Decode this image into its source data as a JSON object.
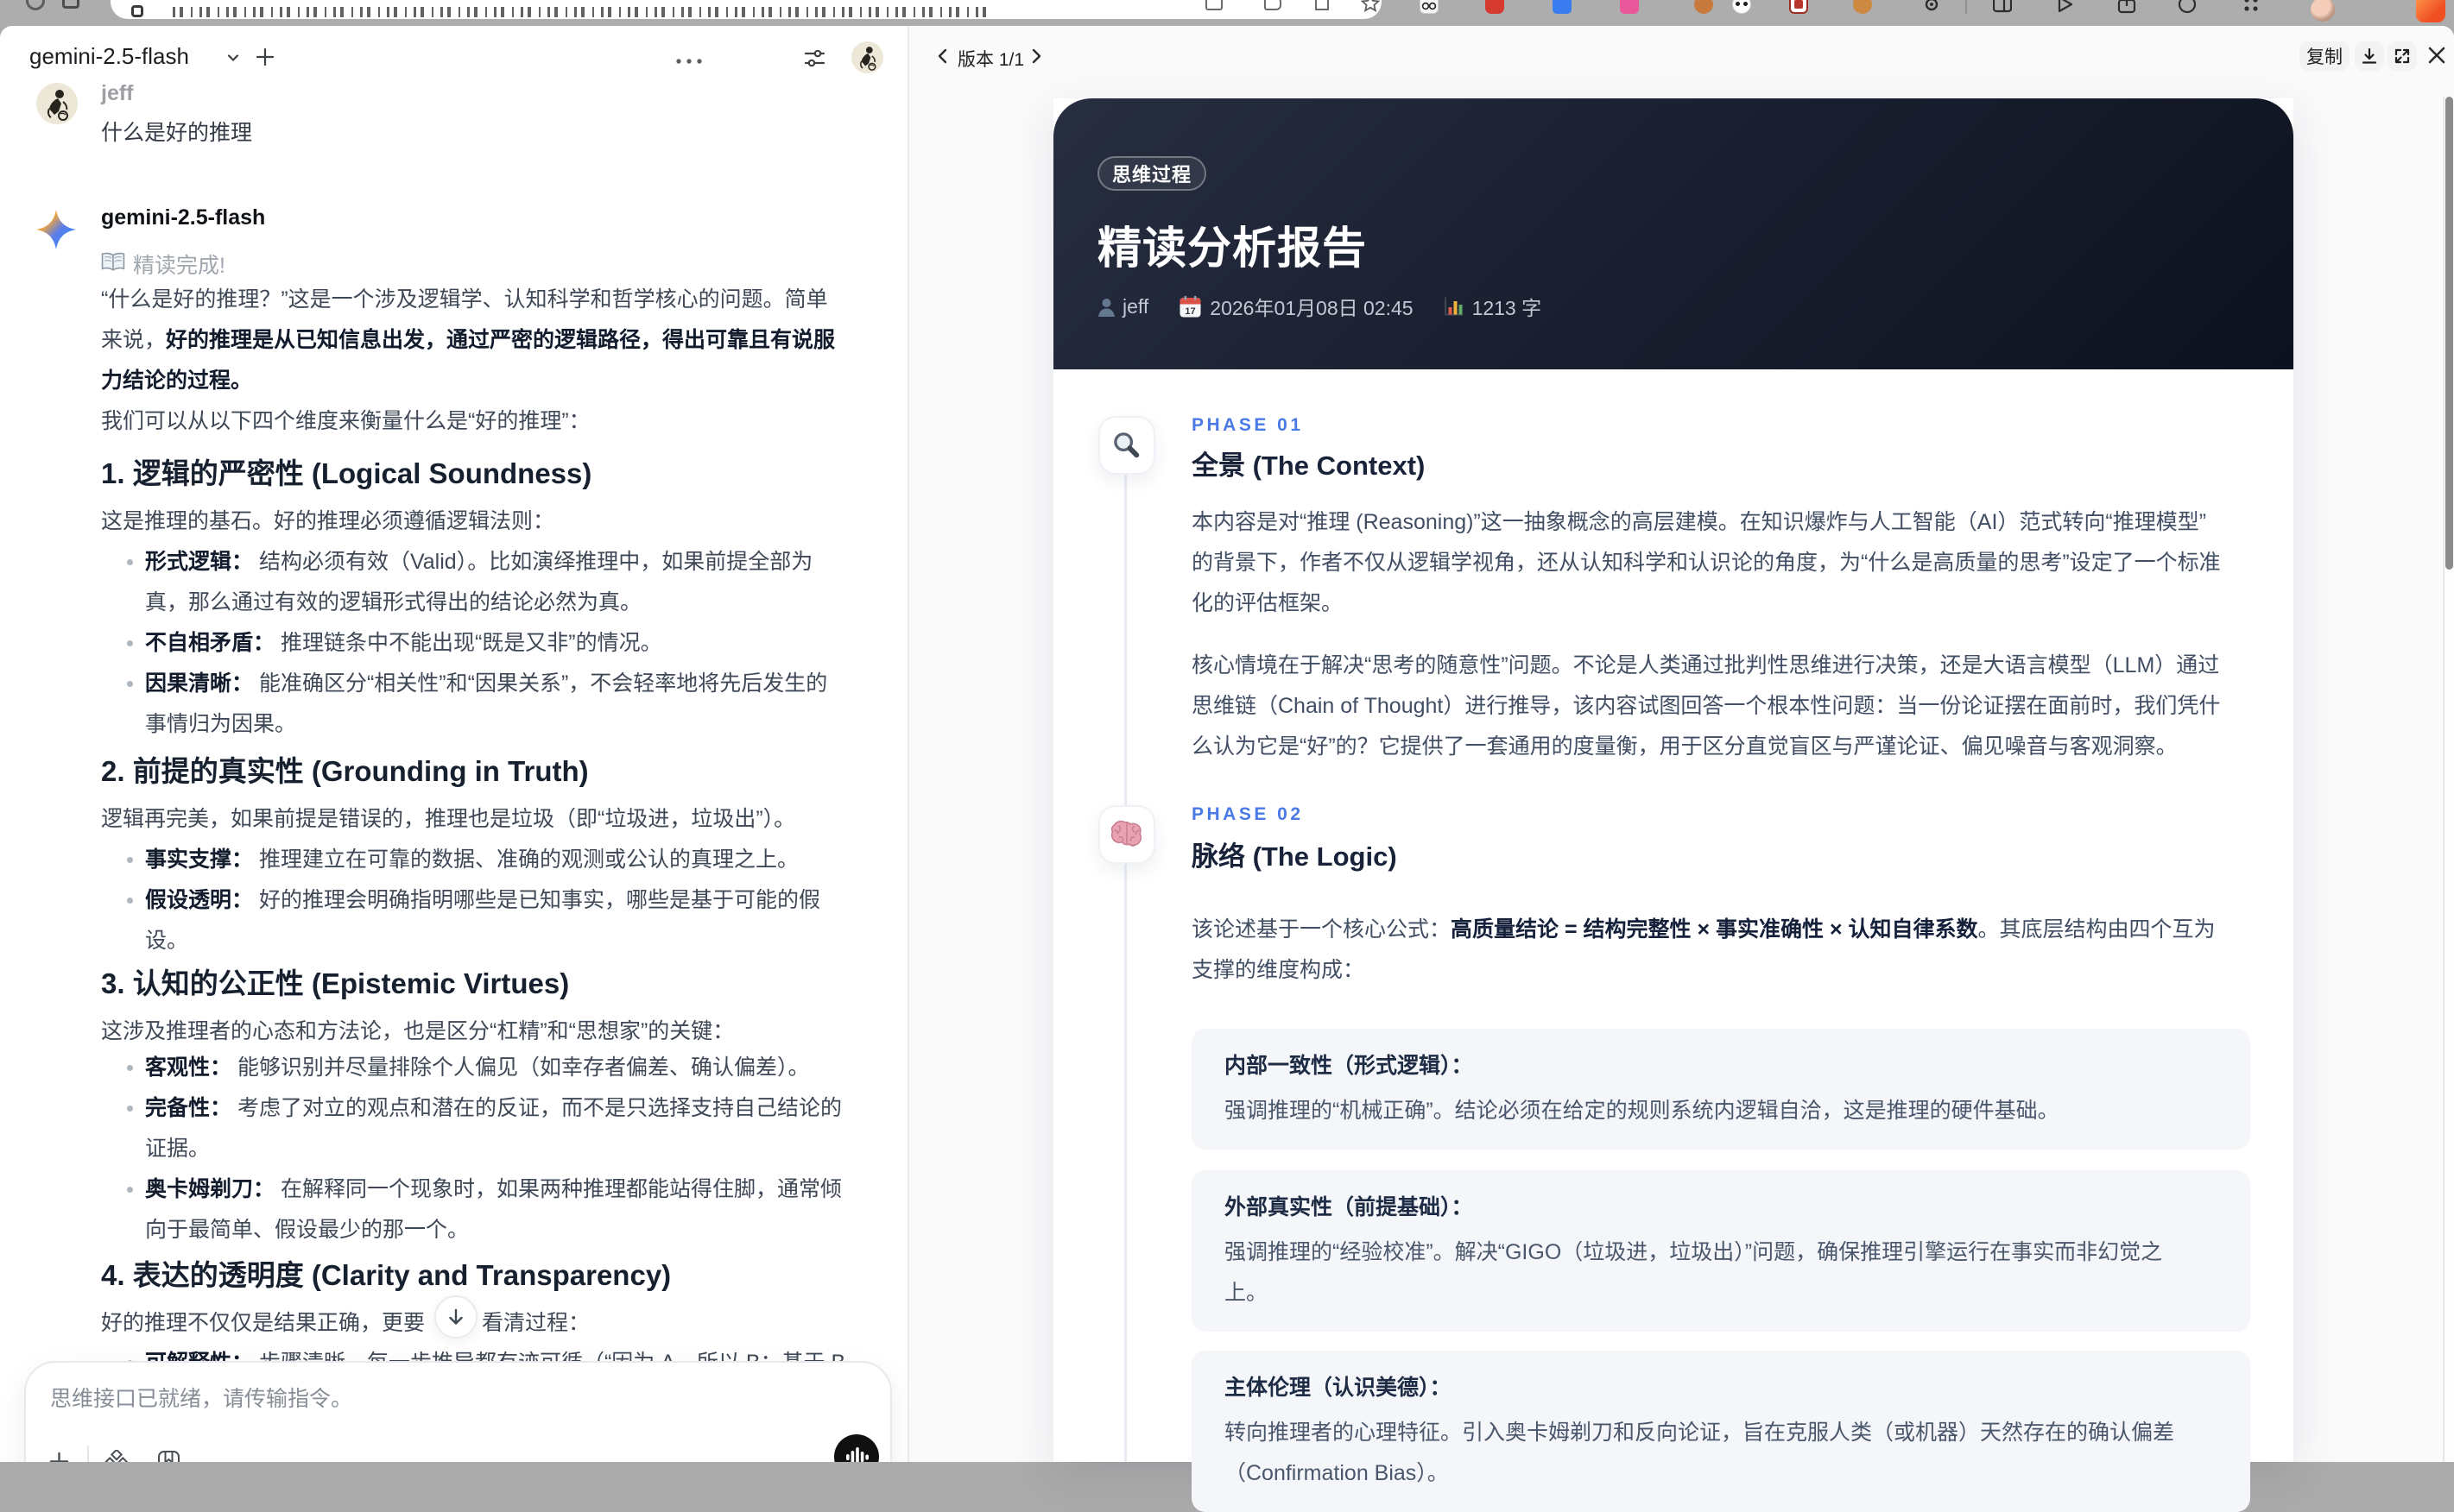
{
  "browser": {
    "strip_color": "#adadad",
    "address_bar": {
      "text": "",
      "icons": [
        "reader-icon",
        "speaker-mute-icon",
        "share-icon",
        "bookmark-star-icon"
      ]
    },
    "toolbar_icons": [
      "reload-icon",
      "tab-grid-icon",
      "glasses-extension-icon",
      "shield-extension-icon",
      "blue-extension-icon",
      "pink-extension-icon",
      "orange-dot-extension-icon",
      "panda-extension-icon",
      "red-book-extension-icon",
      "orange-ball-extension-icon",
      "gear-extension-icon",
      "split-view-icon",
      "play-icon",
      "share-box-icon",
      "smiley-icon",
      "grid-dots-icon",
      "profile-avatar",
      "flame-app-icon"
    ]
  },
  "chat": {
    "header": {
      "title": "gemini-2.5-flash",
      "icons": [
        "chevron-down-icon",
        "plus-icon",
        "ellipsis-icon",
        "sliders-icon",
        "user-avatar"
      ]
    },
    "user_message": {
      "author": "jeff",
      "text": "什么是好的推理"
    },
    "assistant": {
      "author": "gemini-2.5-flash",
      "status": "精读完成!",
      "p1l1": "“什么是好的推理？”这是一个涉及逻辑学、认知科学和哲学核心的问题。简单",
      "p1l2a": "来说，",
      "p1l2b": "好的推理是从已知信息出发，通过严密的逻辑路径，得出可靠且有说服",
      "p1l3": "力结论的过程。",
      "p2": "我们可以从以下四个维度来衡量什么是“好的推理”：",
      "h1": "1. 逻辑的严密性 (Logical Soundness)",
      "s1p": "这是推理的基石。好的推理必须遵循逻辑法则：",
      "s1b1a": "形式逻辑：",
      "s1b1b": " 结构必须有效（Valid）。比如演绎推理中，如果前提全部为",
      "s1b1c": "真，那么通过有效的逻辑形式得出的结论必然为真。",
      "s1b2a": "不自相矛盾：",
      "s1b2b": " 推理链条中不能出现“既是又非”的情况。",
      "s1b3a": "因果清晰：",
      "s1b3b": " 能准确区分“相关性”和“因果关系”，不会轻率地将先后发生的",
      "s1b3c": "事情归为因果。",
      "h2": "2. 前提的真实性 (Grounding in Truth)",
      "s2p": "逻辑再完美，如果前提是错误的，推理也是垃圾（即“垃圾进，垃圾出”）。",
      "s2b1a": "事实支撑：",
      "s2b1b": " 推理建立在可靠的数据、准确的观测或公认的真理之上。",
      "s2b2a": "假设透明：",
      "s2b2b": " 好的推理会明确指明哪些是已知事实，哪些是基于可能的假",
      "s2b2c": "设。",
      "h3": "3. 认知的公正性 (Epistemic Virtues)",
      "s3p": "这涉及推理者的心态和方法论，也是区分“杠精”和“思想家”的关键：",
      "s3b1a": "客观性：",
      "s3b1b": " 能够识别并尽量排除个人偏见（如幸存者偏差、确认偏差）。",
      "s3b2a": "完备性：",
      "s3b2b": " 考虑了对立的观点和潜在的反证，而不是只选择支持自己结论的",
      "s3b2c": "证据。",
      "s3b3a": "奥卡姆剃刀：",
      "s3b3b": " 在解释同一个现象时，如果两种推理都能站得住脚，通常倾",
      "s3b3c": "向于最简单、假设最少的那一个。",
      "h4": "4. 表达的透明度 (Clarity and Transparency)",
      "s4pa": "好的推理不仅仅是结果正确，更要",
      "s4pb": "看清过程：",
      "s4b1a": "可解释性：",
      "s4b1b": " 步骤清晰，每一步推导都有迹可循（“因为 A，所以 B；基于 B"
    },
    "composer": {
      "placeholder": "思维接口已就绪，请传输指令。",
      "icons": [
        "plus-icon",
        "sparkle-icon",
        "bookmark-icon",
        "voice-wave-button"
      ]
    }
  },
  "artifact": {
    "toolbar": {
      "version_label": "版本 1/1",
      "copy_label": "复制",
      "icons": [
        "chevron-left-icon",
        "chevron-right-icon",
        "download-icon",
        "fullscreen-icon",
        "close-icon"
      ]
    },
    "hero": {
      "badge": "思维过程",
      "title": "精读分析报告",
      "author": "jeff",
      "date": "2026年01月08日 02:45",
      "word_count": "1213 字"
    },
    "phase1": {
      "label": "PHASE 01",
      "title": "全景 (The Context)",
      "icon": "magnifier-icon",
      "p1l1": "本内容是对“推理 (Reasoning)”这一抽象概念的高层建模。在知识爆炸与人工智能（AI）范式转向“推理模型”",
      "p1l2": "的背景下，作者不仅从逻辑学视角，还从认知科学和认识论的角度，为“什么是高质量的思考”设定了一个标准",
      "p1l3": "化的评估框架。",
      "p2l1": "核心情境在于解决“思考的随意性”问题。不论是人类通过批判性思维进行决策，还是大语言模型（LLM）通过",
      "p2l2": "思维链（Chain of Thought）进行推导，该内容试图回答一个根本性问题：当一份论证摆在面前时，我们凭什",
      "p2l3": "么认为它是“好”的？它提供了一套通用的度量衡，用于区分直觉盲区与严谨论证、偏见噪音与客观洞察。"
    },
    "phase2": {
      "label": "PHASE 02",
      "title": "脉络 (The Logic)",
      "icon": "brain-icon",
      "pl1a": "该论述基于一个核心公式：",
      "pl1b": "高质量结论 = 结构完整性 × 事实准确性 × 认知自律系数",
      "pl1c": "。其底层结构由四个互为",
      "pl2": "支撑的维度构成：",
      "cards": [
        {
          "title": "内部一致性（形式逻辑）：",
          "l1": "强调推理的“机械正确”。结论必须在给定的规则系统内逻辑自洽，这是推理的硬件基础。",
          "l2": ""
        },
        {
          "title": "外部真实性（前提基础）：",
          "l1": "强调推理的“经验校准”。解决“GIGO（垃圾进，垃圾出）”问题，确保推理引擎运行在事实而非幻觉之",
          "l2": "上。"
        },
        {
          "title": "主体伦理（认识美德）：",
          "l1": "转向推理者的心理特征。引入奥卡姆剃刀和反向论证，旨在克服人类（或机器）天然存在的确认偏差",
          "l2": "（Confirmation Bias）。"
        }
      ]
    },
    "colors": {
      "accent_blue": "#4a7ae6",
      "hero_gradient_from": "#272e40",
      "hero_gradient_to": "#0e1220",
      "card_bg": "#f4f6f9"
    }
  }
}
